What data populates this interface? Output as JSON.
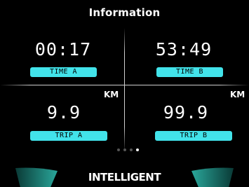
{
  "header": {
    "title": "Information"
  },
  "time_a": {
    "value": "00:17",
    "label": "TIME A"
  },
  "time_b": {
    "value": "53:49",
    "label": "TIME B"
  },
  "trip_a": {
    "unit": "KM",
    "value": "9.9",
    "label": "TRIP A"
  },
  "trip_b": {
    "unit": "KM",
    "value": "99.9",
    "label": "TRIP B"
  },
  "pager": {
    "total": 4,
    "active": 4
  },
  "footer": {
    "mode": "INTELLIGENT"
  },
  "colors": {
    "accent": "#42e3ea",
    "background": "#000000",
    "text": "#ffffff"
  }
}
